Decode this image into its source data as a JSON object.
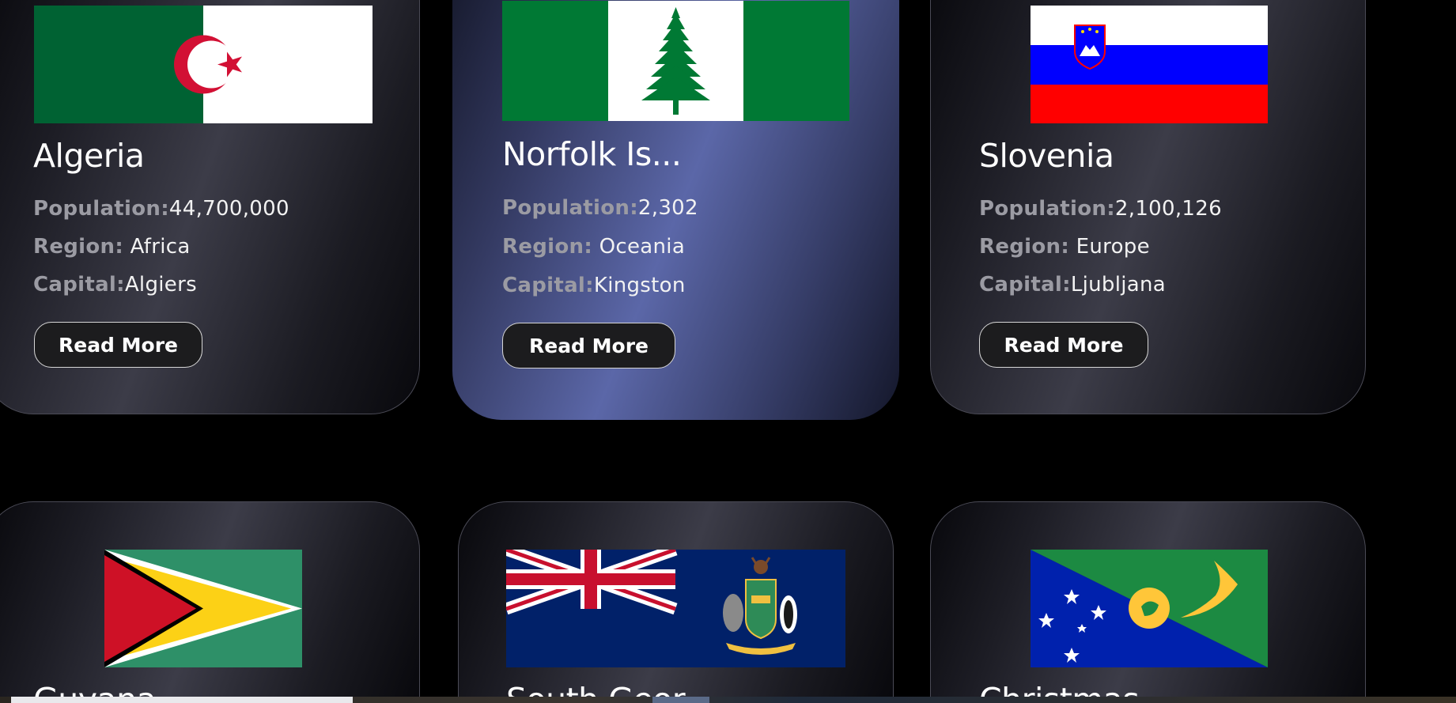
{
  "countries": [
    {
      "name": "Algeria",
      "population_label": "Population:",
      "population": "44,700,000",
      "region_label": "Region:",
      "region": "Africa",
      "capital_label": "Capital:",
      "capital": "Algiers",
      "button": "Read More"
    },
    {
      "name": "Norfolk Is...",
      "population_label": "Population:",
      "population": "2,302",
      "region_label": "Region:",
      "region": "Oceania",
      "capital_label": "Capital:",
      "capital": "Kingston",
      "button": "Read More"
    },
    {
      "name": "Slovenia",
      "population_label": "Population:",
      "population": "2,100,126",
      "region_label": "Region:",
      "region": "Europe",
      "capital_label": "Capital:",
      "capital": "Ljubljana",
      "button": "Read More"
    },
    {
      "name": "Guyana"
    },
    {
      "name": "South Geor"
    },
    {
      "name": "Christmas"
    }
  ],
  "colors": {
    "page_background": "#000000",
    "card_border": "#4a4a55",
    "active_card_accent": "#5b67a8",
    "label_color": "#9b9ba3",
    "button_background": "#1c1c1e"
  },
  "icons": {
    "flag_algeria": "algeria-flag-icon",
    "flag_norfolk": "norfolk-island-flag-icon",
    "flag_slovenia": "slovenia-flag-icon",
    "flag_guyana": "guyana-flag-icon",
    "flag_south_georgia": "south-georgia-flag-icon",
    "flag_christmas": "christmas-island-flag-icon"
  }
}
